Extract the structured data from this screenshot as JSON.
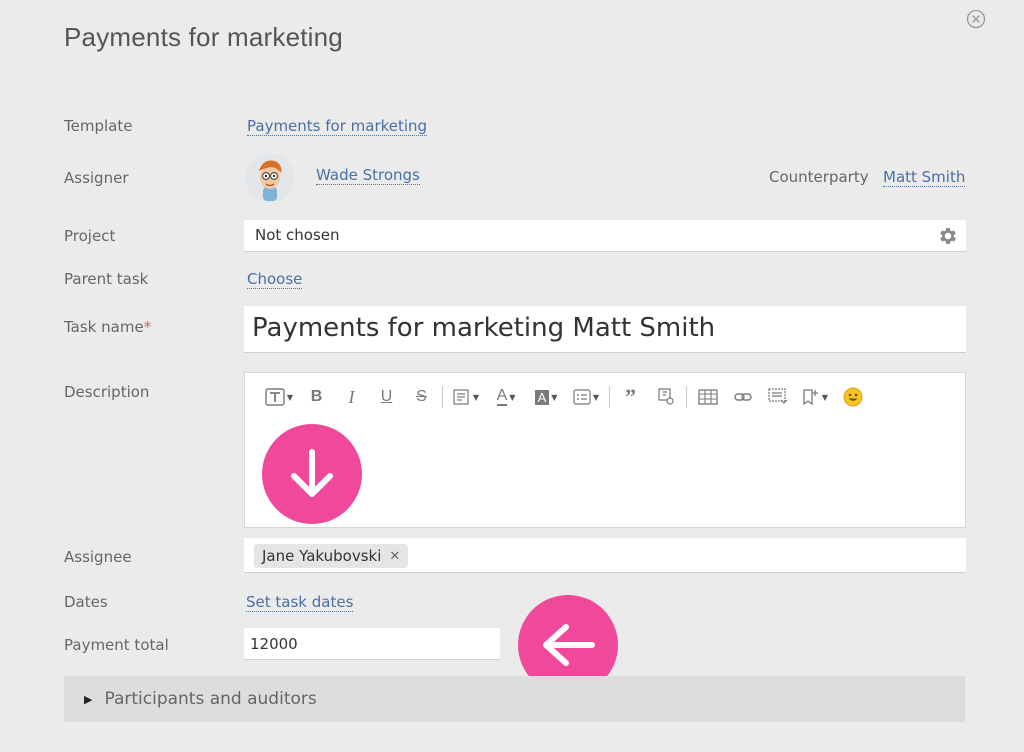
{
  "title": "Payments for marketing",
  "fields": {
    "template": {
      "label": "Template",
      "value": "Payments for marketing"
    },
    "assigner": {
      "label": "Assigner",
      "value": "Wade Strongs"
    },
    "counterparty": {
      "label": "Counterparty",
      "value": "Matt Smith"
    },
    "project": {
      "label": "Project",
      "value": "Not chosen"
    },
    "parent_task": {
      "label": "Parent task",
      "value": "Choose"
    },
    "task_name": {
      "label": "Task name",
      "required_mark": "*",
      "value": "Payments for marketing Matt Smith"
    },
    "description": {
      "label": "Description",
      "value": ""
    },
    "assignee": {
      "label": "Assignee",
      "value": "Jane Yakubovski"
    },
    "dates": {
      "label": "Dates",
      "value": "Set task dates"
    },
    "payment_total": {
      "label": "Payment total",
      "value": "12000"
    }
  },
  "participants": {
    "label": "Participants and auditors"
  },
  "colors": {
    "accent_link": "#4a6fa5",
    "pink": "#f0489a",
    "background": "#ebebeb",
    "required": "#e05a5a"
  }
}
